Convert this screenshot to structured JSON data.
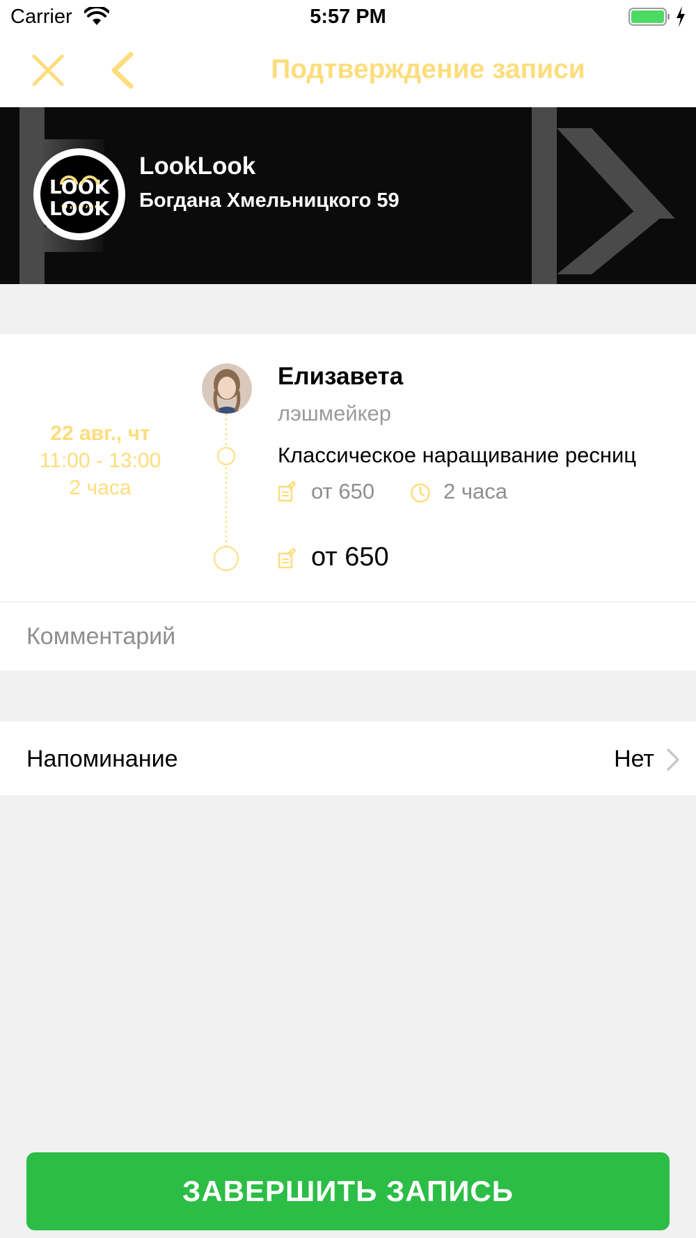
{
  "status_bar": {
    "carrier": "Carrier",
    "time": "5:57 PM",
    "battery_color": "#4cd964"
  },
  "nav": {
    "title": "Подтверждение записи",
    "accent_color": "#fddd7c",
    "close_icon": "close-icon",
    "back_icon": "chevron-left-icon"
  },
  "salon": {
    "name": "LookLook",
    "address": "Богдана Хмельницкого 59",
    "logo": {
      "line1": "LOOK",
      "line2": "LOOK"
    }
  },
  "booking": {
    "date": "22 авг., чт",
    "time_range": "11:00 - 13:00",
    "duration": "2 часа",
    "master": {
      "name": "Елизавета",
      "role": "лэшмейкер"
    },
    "service": {
      "name": "Классическое наращивание ресниц",
      "price": "от 650",
      "duration": "2 часа"
    },
    "total": "от 650"
  },
  "comment": {
    "placeholder": "Комментарий",
    "value": ""
  },
  "reminder": {
    "label": "Напоминание",
    "value": "Нет"
  },
  "finish_button": {
    "label": "ЗАВЕРШИТЬ ЗАПИСЬ",
    "color": "#2bbd45"
  }
}
